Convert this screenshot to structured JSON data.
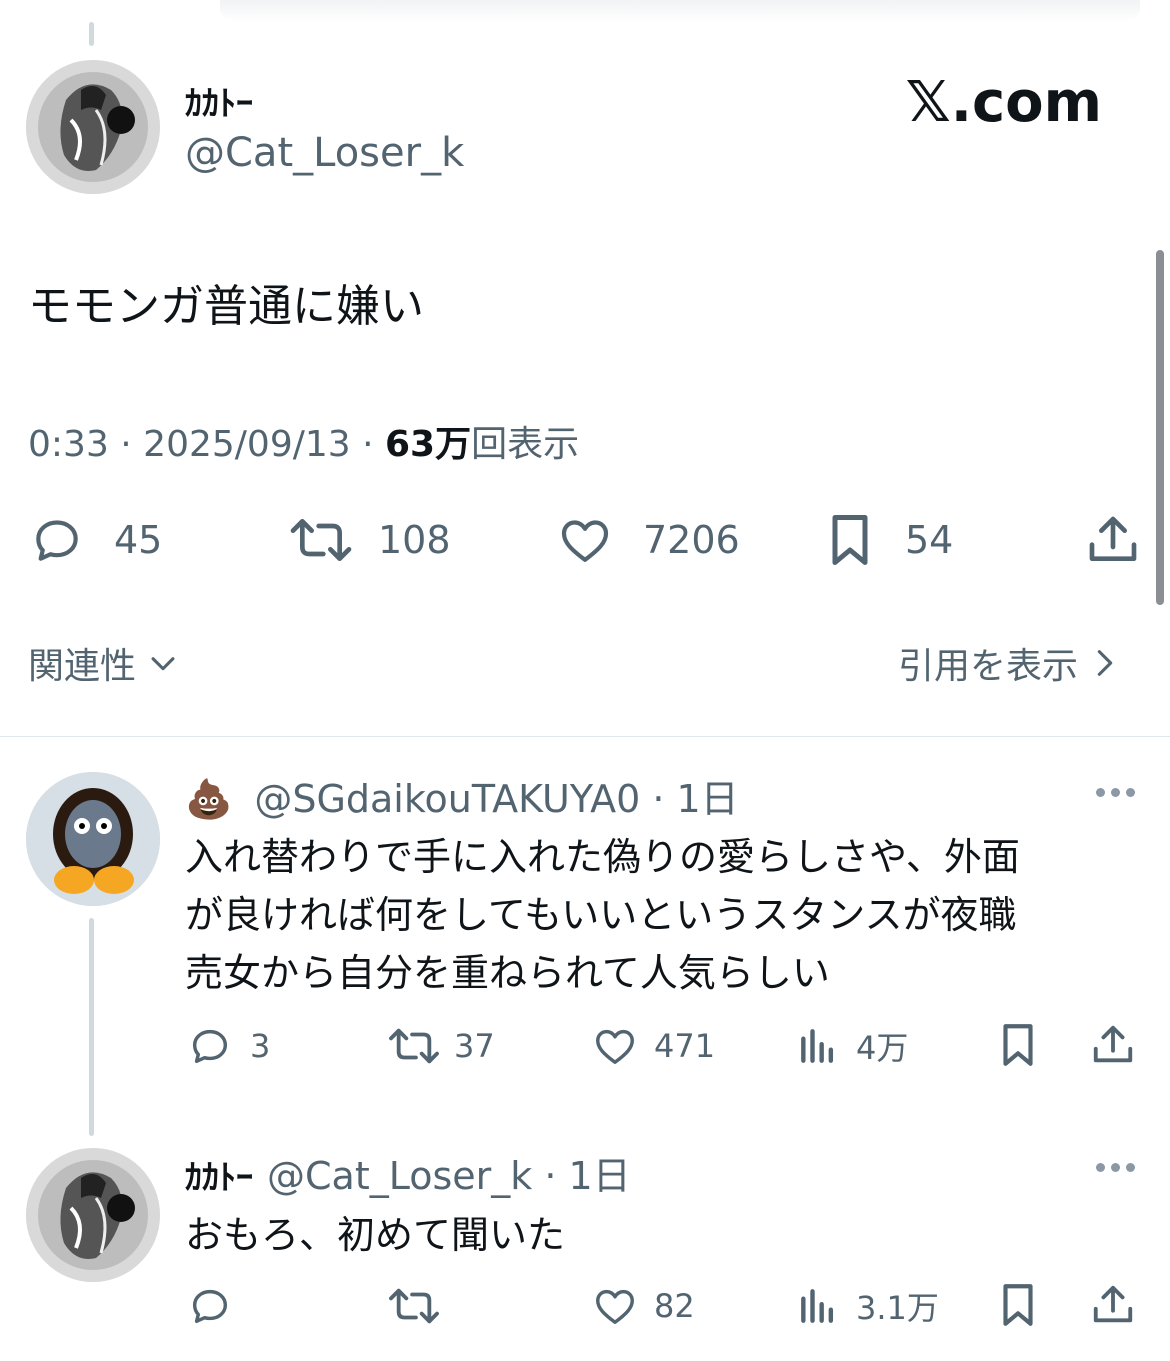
{
  "header": {
    "brand": "𝕏.com"
  },
  "main_tweet": {
    "display_name": "ｶｶﾄｰ",
    "handle": "@Cat_Loser_k",
    "text": "モモンガ普通に嫌い",
    "time": "0:33 · 2025/09/13 · ",
    "views_count": "63万",
    "views_label": "回表示",
    "actions": {
      "replies": "45",
      "retweets": "108",
      "likes": "7206",
      "bookmarks": "54"
    }
  },
  "controls": {
    "sort_label": "関連性",
    "quotes_label": "引用を表示"
  },
  "replies": [
    {
      "emoji": "💩",
      "handle": "@SGdaikouTAKUYA0",
      "time": " · 1日",
      "lines": [
        "入れ替わりで手に入れた偽りの愛らしさや、外面",
        "が良ければ何をしてもいいというスタンスが夜職",
        "売女から自分を重ねられて人気らしい"
      ],
      "actions": {
        "replies": "3",
        "retweets": "37",
        "likes": "471",
        "views": "4万"
      }
    },
    {
      "display_name": "ｶｶﾄｰ",
      "handle": "@Cat_Loser_k",
      "time": " · 1日",
      "text": "おもろ、初めて聞いた",
      "actions": {
        "replies": "",
        "retweets": "",
        "likes": "82",
        "views": "3.1万"
      }
    }
  ],
  "icons": [
    "reply-icon",
    "retweet-icon",
    "like-icon",
    "bookmark-icon",
    "share-icon",
    "views-icon",
    "chevron-down-icon",
    "chevron-right-icon",
    "more-icon"
  ]
}
